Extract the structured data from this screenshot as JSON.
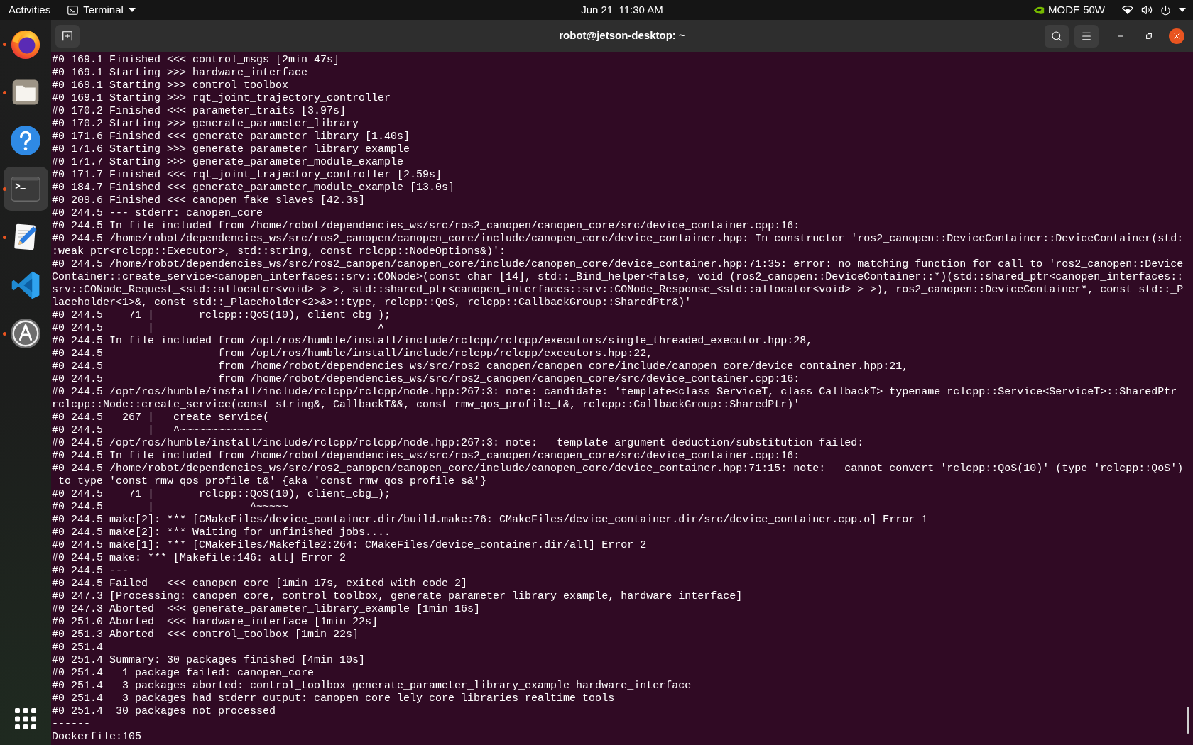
{
  "top_bar": {
    "activities": "Activities",
    "app_menu": "Terminal",
    "clock": "Jun 21  11:30 AM",
    "power_mode": "MODE 50W"
  },
  "dock": {
    "items": [
      {
        "kind": "browser",
        "running": true,
        "selected": false
      },
      {
        "kind": "files",
        "running": true,
        "selected": false
      },
      {
        "kind": "help",
        "running": false,
        "selected": false
      },
      {
        "kind": "terminal",
        "running": true,
        "selected": true
      },
      {
        "kind": "editor",
        "running": true,
        "selected": false
      },
      {
        "kind": "code",
        "running": false,
        "selected": false
      },
      {
        "kind": "software",
        "running": true,
        "selected": false
      }
    ]
  },
  "window": {
    "title": "robot@jetson-desktop: ~"
  },
  "terminal": {
    "lines": [
      "#0 169.1 Finished <<< control_msgs [2min 47s]",
      "#0 169.1 Starting >>> hardware_interface",
      "#0 169.1 Starting >>> control_toolbox",
      "#0 169.1 Starting >>> rqt_joint_trajectory_controller",
      "#0 170.2 Finished <<< parameter_traits [3.97s]",
      "#0 170.2 Starting >>> generate_parameter_library",
      "#0 171.6 Finished <<< generate_parameter_library [1.40s]",
      "#0 171.6 Starting >>> generate_parameter_library_example",
      "#0 171.7 Starting >>> generate_parameter_module_example",
      "#0 171.7 Finished <<< rqt_joint_trajectory_controller [2.59s]",
      "#0 184.7 Finished <<< generate_parameter_module_example [13.0s]",
      "#0 209.6 Finished <<< canopen_fake_slaves [42.3s]",
      "#0 244.5 --- stderr: canopen_core",
      "#0 244.5 In file included from /home/robot/dependencies_ws/src/ros2_canopen/canopen_core/src/device_container.cpp:16:",
      "#0 244.5 /home/robot/dependencies_ws/src/ros2_canopen/canopen_core/include/canopen_core/device_container.hpp: In constructor 'ros2_canopen::DeviceContainer::DeviceContainer(std:",
      ":weak_ptr<rclcpp::Executor>, std::string, const rclcpp::NodeOptions&)':",
      "#0 244.5 /home/robot/dependencies_ws/src/ros2_canopen/canopen_core/include/canopen_core/device_container.hpp:71:35: error: no matching function for call to 'ros2_canopen::Device",
      "Container::create_service<canopen_interfaces::srv::CONode>(const char [14], std::_Bind_helper<false, void (ros2_canopen::DeviceContainer::*)(std::shared_ptr<canopen_interfaces::",
      "srv::CONode_Request_<std::allocator<void> > >, std::shared_ptr<canopen_interfaces::srv::CONode_Response_<std::allocator<void> > >), ros2_canopen::DeviceContainer*, const std::_P",
      "laceholder<1>&, const std::_Placeholder<2>&>::type, rclcpp::QoS, rclcpp::CallbackGroup::SharedPtr&)'",
      "#0 244.5    71 |       rclcpp::QoS(10), client_cbg_);",
      "#0 244.5       |                                   ^",
      "#0 244.5 In file included from /opt/ros/humble/install/include/rclcpp/rclcpp/executors/single_threaded_executor.hpp:28,",
      "#0 244.5                  from /opt/ros/humble/install/include/rclcpp/rclcpp/executors.hpp:22,",
      "#0 244.5                  from /home/robot/dependencies_ws/src/ros2_canopen/canopen_core/include/canopen_core/device_container.hpp:21,",
      "#0 244.5                  from /home/robot/dependencies_ws/src/ros2_canopen/canopen_core/src/device_container.cpp:16:",
      "#0 244.5 /opt/ros/humble/install/include/rclcpp/rclcpp/node.hpp:267:3: note: candidate: 'template<class ServiceT, class CallbackT> typename rclcpp::Service<ServiceT>::SharedPtr",
      "rclcpp::Node::create_service(const string&, CallbackT&&, const rmw_qos_profile_t&, rclcpp::CallbackGroup::SharedPtr)'",
      "#0 244.5   267 |   create_service(",
      "#0 244.5       |   ^~~~~~~~~~~~~~",
      "#0 244.5 /opt/ros/humble/install/include/rclcpp/rclcpp/node.hpp:267:3: note:   template argument deduction/substitution failed:",
      "#0 244.5 In file included from /home/robot/dependencies_ws/src/ros2_canopen/canopen_core/src/device_container.cpp:16:",
      "#0 244.5 /home/robot/dependencies_ws/src/ros2_canopen/canopen_core/include/canopen_core/device_container.hpp:71:15: note:   cannot convert 'rclcpp::QoS(10)' (type 'rclcpp::QoS')",
      " to type 'const rmw_qos_profile_t&' {aka 'const rmw_qos_profile_s&'}",
      "#0 244.5    71 |       rclcpp::QoS(10), client_cbg_);",
      "#0 244.5       |               ^~~~~~",
      "#0 244.5 make[2]: *** [CMakeFiles/device_container.dir/build.make:76: CMakeFiles/device_container.dir/src/device_container.cpp.o] Error 1",
      "#0 244.5 make[2]: *** Waiting for unfinished jobs....",
      "#0 244.5 make[1]: *** [CMakeFiles/Makefile2:264: CMakeFiles/device_container.dir/all] Error 2",
      "#0 244.5 make: *** [Makefile:146: all] Error 2",
      "#0 244.5 ---",
      "#0 244.5 Failed   <<< canopen_core [1min 17s, exited with code 2]",
      "#0 247.3 [Processing: canopen_core, control_toolbox, generate_parameter_library_example, hardware_interface]",
      "#0 247.3 Aborted  <<< generate_parameter_library_example [1min 16s]",
      "#0 251.0 Aborted  <<< hardware_interface [1min 22s]",
      "#0 251.3 Aborted  <<< control_toolbox [1min 22s]",
      "#0 251.4",
      "#0 251.4 Summary: 30 packages finished [4min 10s]",
      "#0 251.4   1 package failed: canopen_core",
      "#0 251.4   3 packages aborted: control_toolbox generate_parameter_library_example hardware_interface",
      "#0 251.4   3 packages had stderr output: canopen_core lely_core_libraries realtime_tools",
      "#0 251.4  30 packages not processed",
      "------",
      "Dockerfile:105"
    ]
  }
}
